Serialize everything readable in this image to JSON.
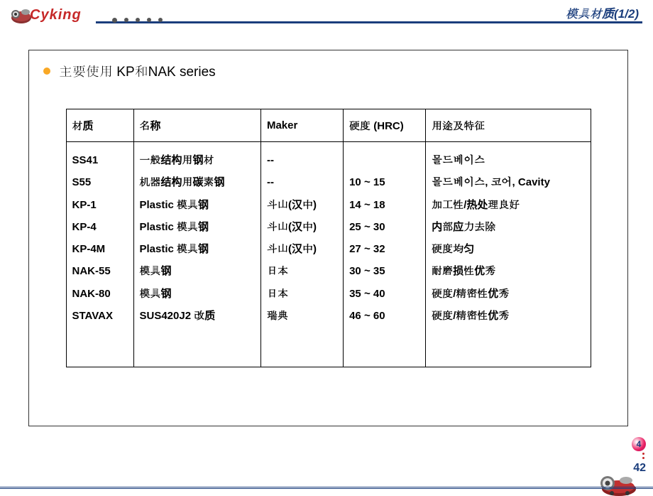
{
  "header": {
    "logo_text": "Cyking",
    "title": "模具材质(1/2)"
  },
  "section": {
    "title": "主要使用 KP和NAK series"
  },
  "table": {
    "headers": {
      "material": "材质",
      "name": "名称",
      "maker": "Maker",
      "hardness": "硬度 (HRC)",
      "usage": "用途及特征"
    },
    "rows": [
      {
        "material": "SS41",
        "name": "一般结构用钢材",
        "maker": "--",
        "hardness": "",
        "usage": "몰드베이스"
      },
      {
        "material": "S55",
        "name": "机器结构用碳素钢",
        "maker": "--",
        "hardness": "10 ~ 15",
        "usage": "몰드베이스, 코어, Cavity"
      },
      {
        "material": "KP-1",
        "name": "Plastic 模具钢",
        "maker": "斗山(汉中)",
        "hardness": "14 ~ 18",
        "usage": "加工性/热处理良好"
      },
      {
        "material": "KP-4",
        "name": "Plastic 模具钢",
        "maker": "斗山(汉中)",
        "hardness": "25 ~ 30",
        "usage": "内部应力去除"
      },
      {
        "material": "KP-4M",
        "name": "Plastic 模具钢",
        "maker": "斗山(汉中)",
        "hardness": "27 ~ 32",
        "usage": "硬度均匀"
      },
      {
        "material": "NAK-55",
        "name": "模具钢",
        "maker": "日本",
        "hardness": "30 ~ 35",
        "usage": "耐磨损性优秀"
      },
      {
        "material": "NAK-80",
        "name": "模具钢",
        "maker": "日本",
        "hardness": "35 ~ 40",
        "usage": "硬度/精密性优秀"
      },
      {
        "material": "STAVAX",
        "name": "SUS420J2 改质",
        "maker": "瑞典",
        "hardness": "46 ~ 60",
        "usage": "硬度/精密性优秀"
      }
    ]
  },
  "footer": {
    "badge": "4",
    "page_number": "42"
  }
}
